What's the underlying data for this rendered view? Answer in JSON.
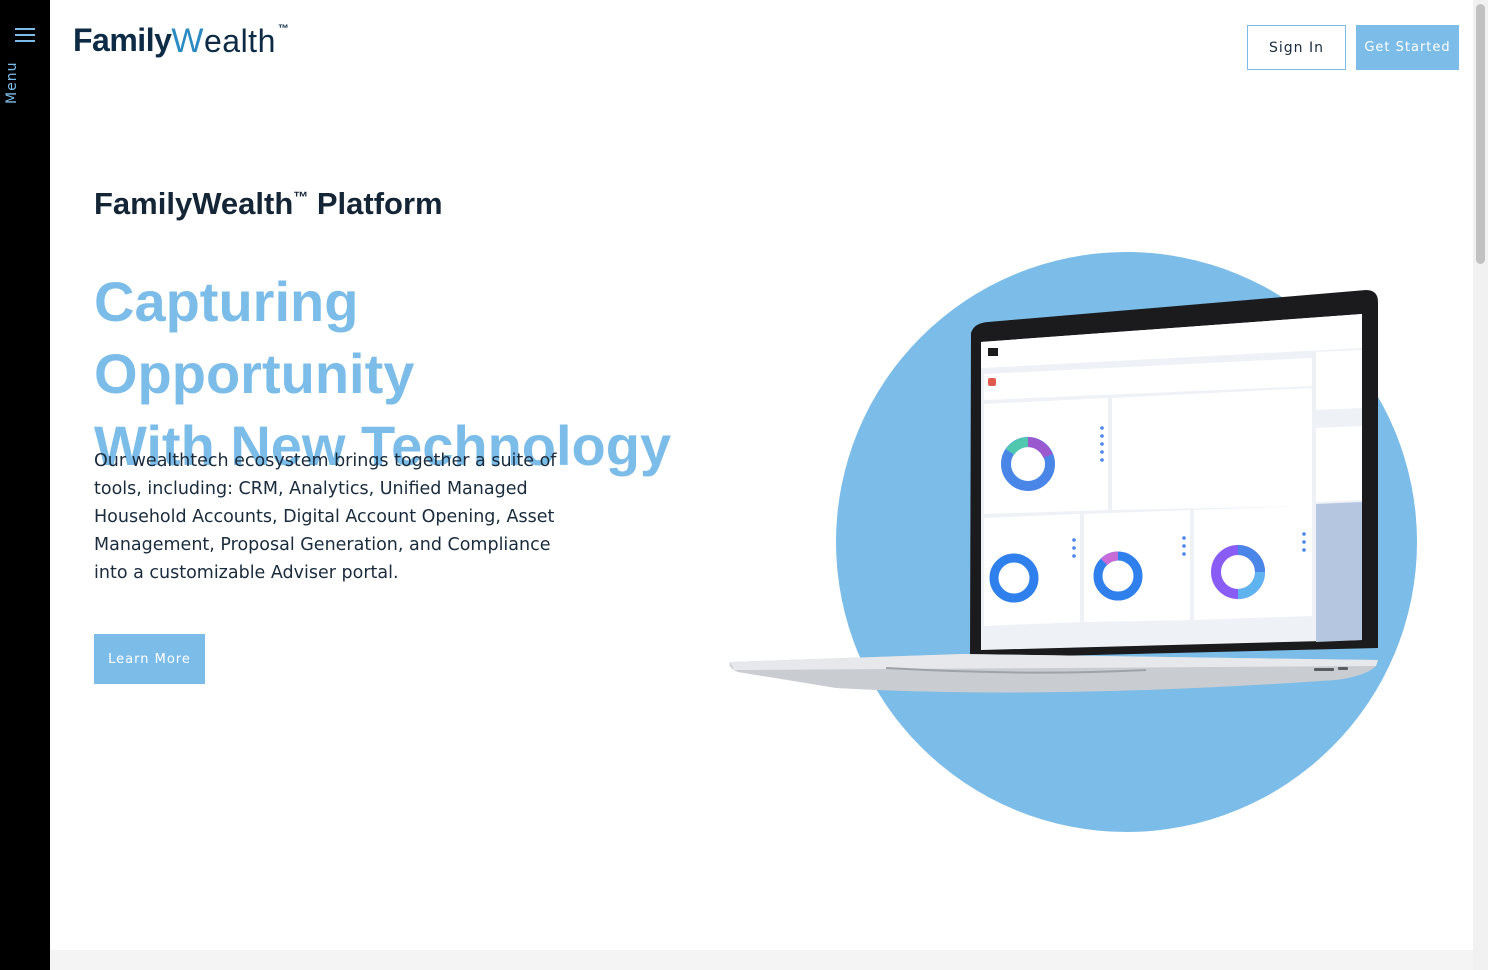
{
  "menu": {
    "label": "Menu"
  },
  "brand": {
    "family": "Family",
    "wealth_w": "W",
    "wealth_rest": "ealth",
    "tm": "™"
  },
  "header": {
    "sign_in": "Sign In",
    "get_started": "Get Started"
  },
  "hero": {
    "platform_name": "FamilyWealth",
    "platform_tm": "™",
    "platform_suffix": " Platform",
    "headline_line1": "Capturing Opportunity",
    "headline_line2": "With New Technology",
    "description": "Our wealthtech ecosystem brings together a suite of tools, including: CRM, Analytics, Unified Managed Household Accounts, Digital Account Opening, Asset Management, Proposal Generation, and Compliance into a customizable Adviser portal.",
    "cta": "Learn More"
  },
  "colors": {
    "accent": "#7bbce8",
    "navy": "#0d2b45",
    "rail": "#000000"
  },
  "icons": {
    "menu": "hamburger-icon"
  }
}
